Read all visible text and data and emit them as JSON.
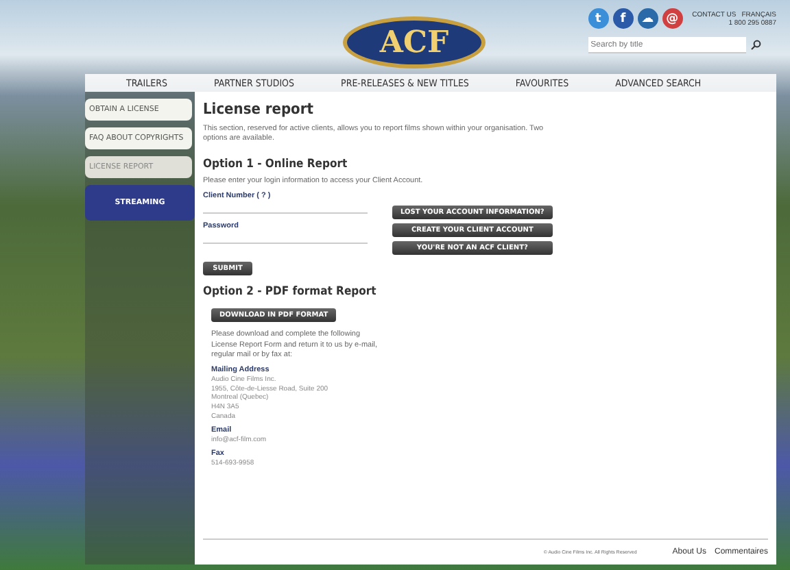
{
  "header": {
    "logo": "ACF",
    "social": [
      "t",
      "f",
      "☁",
      "@"
    ],
    "contact": "CONTACT US",
    "language": "FRANÇAIS",
    "phone": "1 800 295 0887",
    "search": {
      "placeholder": "Search by title"
    }
  },
  "nav": [
    {
      "label": "TRAILERS",
      "selected": false
    },
    {
      "label": "PARTNER STUDIOS",
      "selected": false
    },
    {
      "label": "PRE-RELEASES & NEW TITLES",
      "selected": false
    },
    {
      "label": "FAVOURITES",
      "selected": false
    },
    {
      "label": "ADVANCED SEARCH",
      "selected": false
    }
  ],
  "sidebar": [
    {
      "label": "OBTAIN A LICENSE",
      "selected": false,
      "kind": "tab"
    },
    {
      "label": "FAQ ABOUT COPYRIGHTS",
      "selected": false,
      "kind": "tab"
    },
    {
      "label": "LICENSE REPORT",
      "selected": true,
      "kind": "tab"
    },
    {
      "label": "STREAMING",
      "selected": false,
      "kind": "feature"
    }
  ],
  "content": {
    "title": "License report",
    "intro": "This section, reserved for active clients, allows you to report films shown within your organisation. Two options are available.",
    "option1": {
      "heading": "Option 1 - Online Report",
      "instructions": "Please enter your login information to access your Client Account.",
      "client_label": "Client Number ( ? )",
      "password_label": "Password",
      "submit": "SUBMIT",
      "links": [
        "LOST YOUR ACCOUNT INFORMATION?",
        "CREATE YOUR CLIENT ACCOUNT",
        "YOU'RE NOT AN ACF CLIENT?"
      ]
    },
    "option2": {
      "heading": "Option 2 - PDF format Report",
      "download": "DOWNLOAD IN PDF FORMAT",
      "instructions": "Please download and complete the following License Report Form and return it to us by e-mail, regular mail or by fax at:",
      "contacts": [
        {
          "label": "Mailing Address",
          "lines": [
            "Audio Cine Films Inc.",
            "1955, Côte-de-Liesse Road, Suite 200",
            "Montreal (Quebec)",
            "H4N 3A5",
            "Canada"
          ]
        },
        {
          "label": "Email",
          "lines": [
            "info@acf-film.com"
          ]
        },
        {
          "label": "Fax",
          "lines": [
            "514-693-9958"
          ]
        }
      ]
    }
  },
  "footer": {
    "copyright": "© Audio Cine Films Inc. All Rights Reserved",
    "links": [
      "About Us",
      "Commentaires"
    ]
  }
}
